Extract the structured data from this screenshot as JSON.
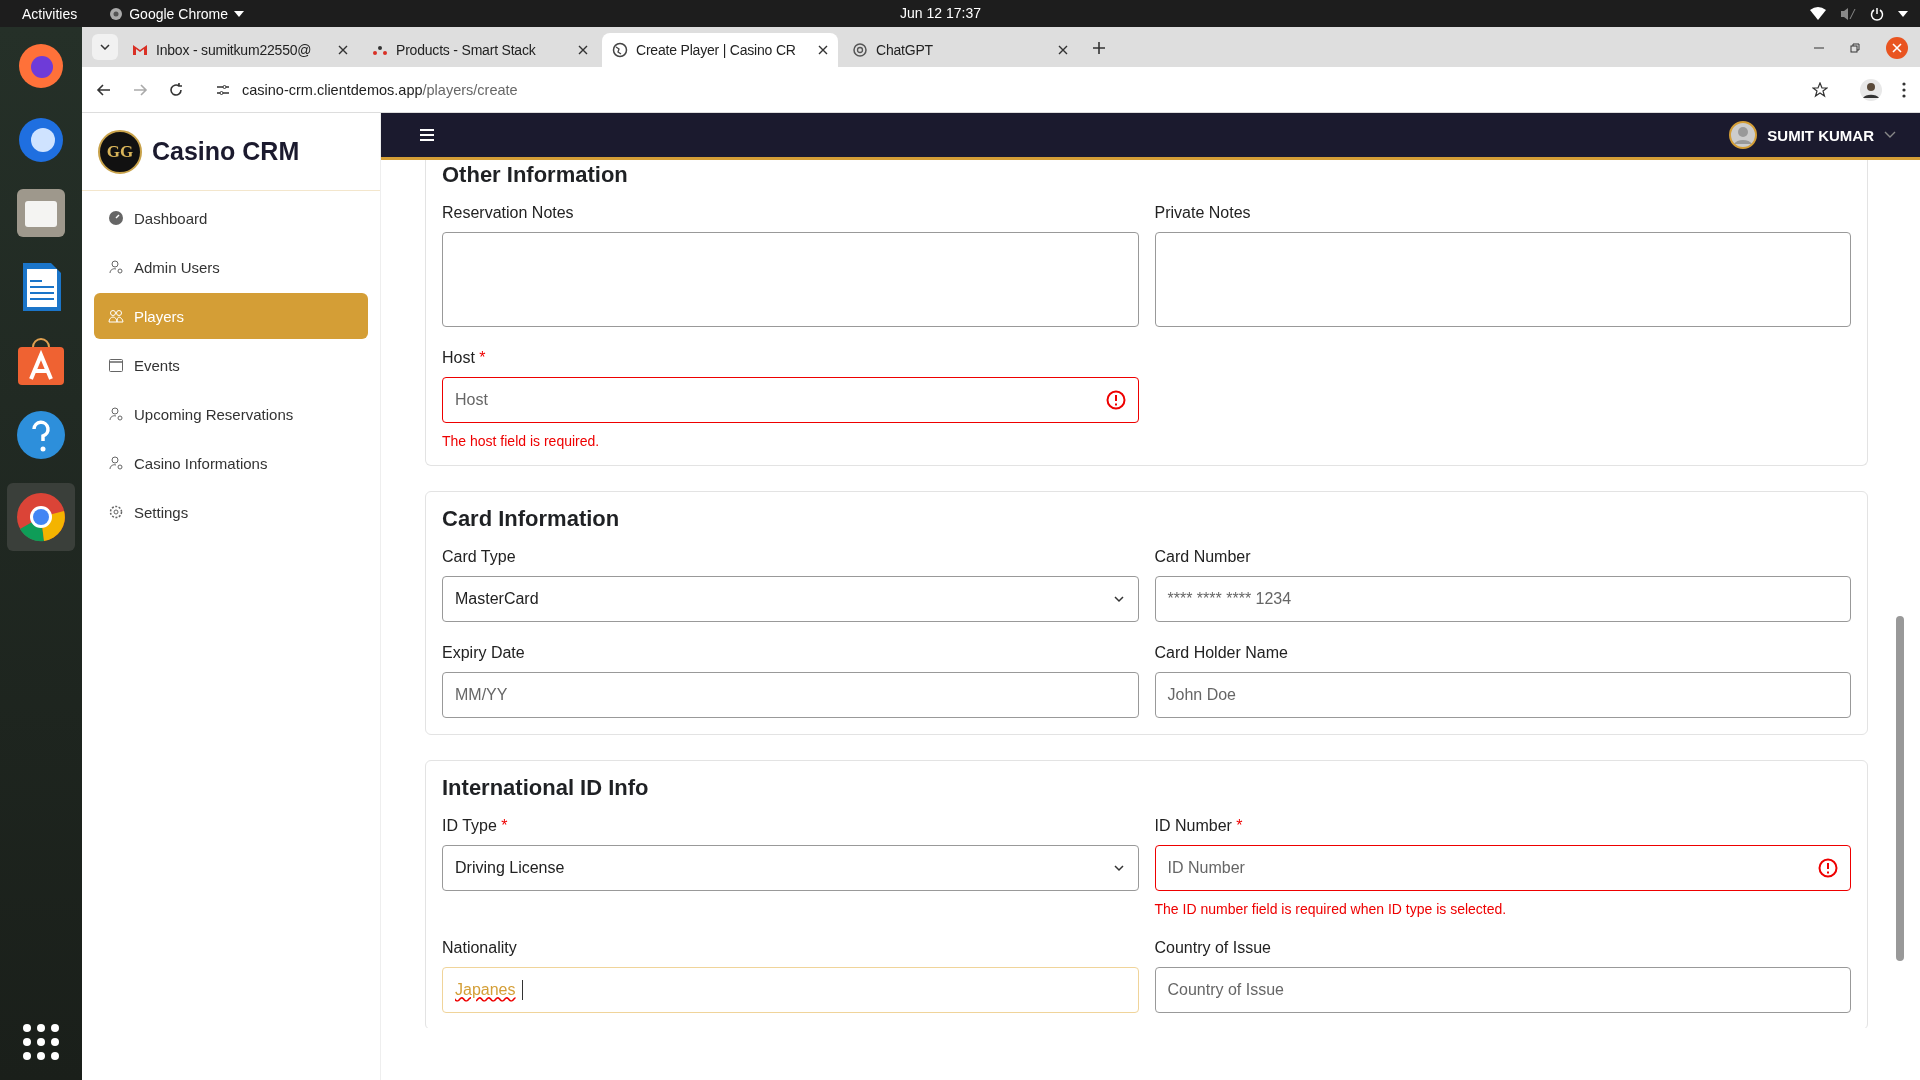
{
  "system_bar": {
    "activities": "Activities",
    "app_name": "Google Chrome",
    "clock": "Jun 12  17:37"
  },
  "browser": {
    "tabs": [
      {
        "title": "Inbox - sumitkum22550@",
        "kind": "mail",
        "selected": false
      },
      {
        "title": "Products - Smart Stack",
        "kind": "stack",
        "selected": false
      },
      {
        "title": "Create Player | Casino CR",
        "kind": "globe",
        "selected": true
      },
      {
        "title": "ChatGPT",
        "kind": "chat",
        "selected": false
      }
    ],
    "url_host": "casino-crm.clientdemos.app",
    "url_path": "/players/create"
  },
  "sidebar": {
    "brand": "Casino CRM",
    "logo": "GG",
    "items": [
      {
        "label": "Dashboard",
        "kind": "dashboard",
        "selected": false
      },
      {
        "label": "Admin Users",
        "kind": "user",
        "selected": false
      },
      {
        "label": "Players",
        "kind": "users",
        "selected": true
      },
      {
        "label": "Events",
        "kind": "calendar",
        "selected": false
      },
      {
        "label": "Upcoming Reservations",
        "kind": "user",
        "selected": false
      },
      {
        "label": "Casino Informations",
        "kind": "user",
        "selected": false
      },
      {
        "label": "Settings",
        "kind": "gear",
        "selected": false
      }
    ]
  },
  "header": {
    "user_name": "SUMIT KUMAR"
  },
  "required_mark": "*",
  "sections": [
    {
      "title": "Other Information",
      "fields": [
        {
          "label": "Reservation Notes",
          "kind": "textarea",
          "required": false
        },
        {
          "label": "Private Notes",
          "kind": "textarea",
          "required": false
        },
        {
          "label": "Host",
          "kind": "input",
          "required": true,
          "placeholder": "Host",
          "error": "The host field is required."
        }
      ]
    },
    {
      "title": "Card Information",
      "fields": [
        {
          "label": "Card Type",
          "kind": "select",
          "required": false,
          "value": "MasterCard"
        },
        {
          "label": "Card Number",
          "kind": "input",
          "required": false,
          "placeholder": "**** **** **** 1234"
        },
        {
          "label": "Expiry Date",
          "kind": "input",
          "required": false,
          "placeholder": "MM/YY"
        },
        {
          "label": "Card Holder Name",
          "kind": "input",
          "required": false,
          "placeholder": "John Doe"
        }
      ]
    },
    {
      "title": "International ID Info",
      "fields": [
        {
          "label": "ID Type",
          "kind": "select",
          "required": true,
          "value": "Driving License"
        },
        {
          "label": "ID Number",
          "kind": "input",
          "required": true,
          "placeholder": "ID Number",
          "error": "The ID number field is required when ID type is selected."
        },
        {
          "label": "Nationality",
          "kind": "input",
          "required": false,
          "value": "Japanes",
          "focused": true
        },
        {
          "label": "Country of Issue",
          "kind": "input",
          "required": false,
          "placeholder": "Country of Issue"
        }
      ]
    }
  ]
}
